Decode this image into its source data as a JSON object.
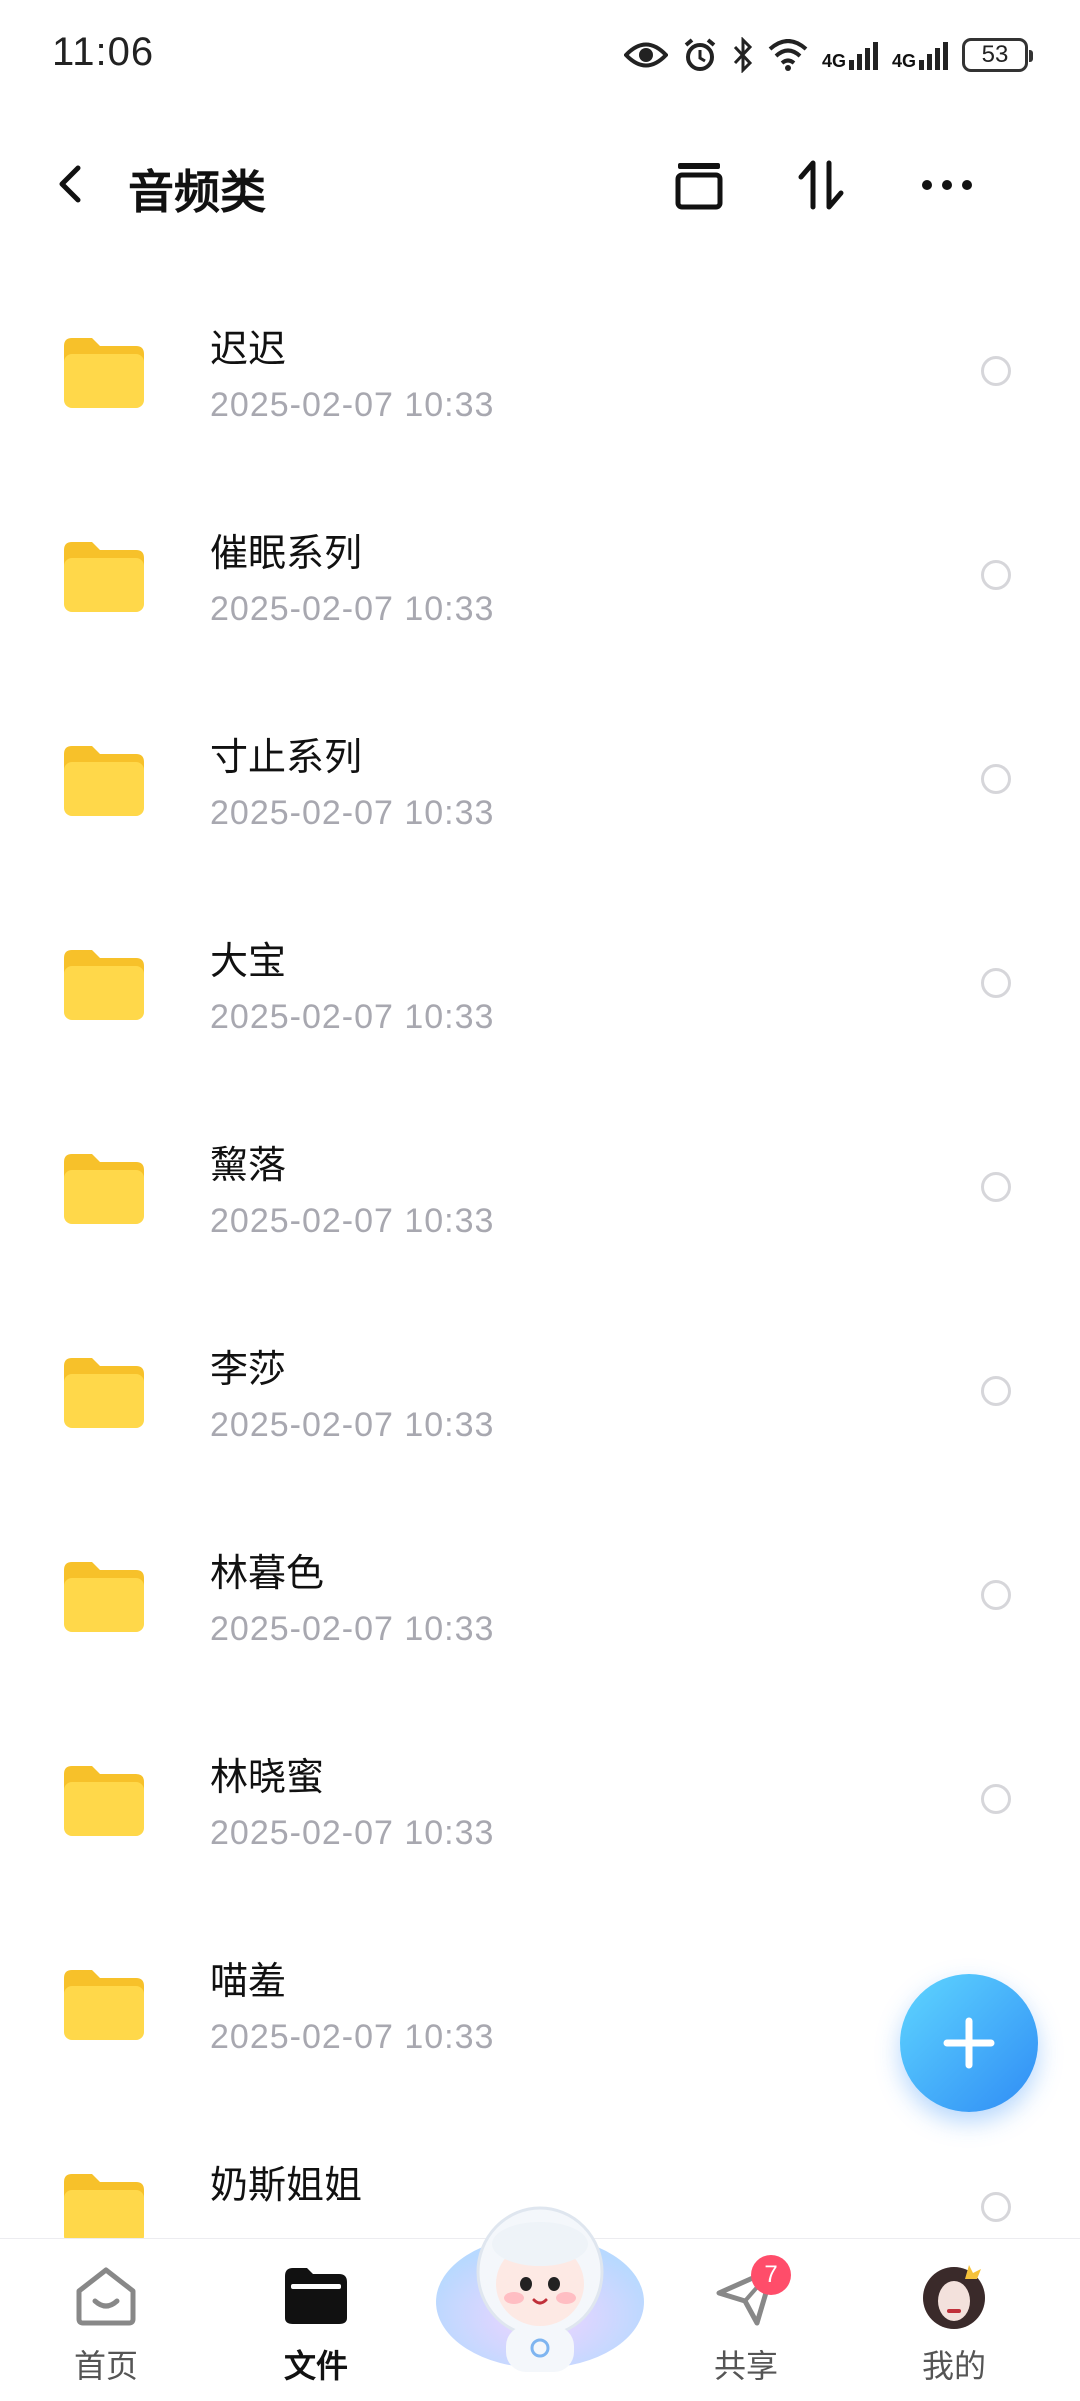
{
  "status_bar": {
    "time": "11:06",
    "network1": "4G",
    "network2": "4G",
    "battery": "53",
    "icons": [
      "eye-icon",
      "alarm-icon",
      "bluetooth-icon",
      "wifi-icon",
      "signal-icon",
      "signal-icon",
      "battery-icon"
    ]
  },
  "header": {
    "title": "音频类",
    "actions": [
      "archive-icon",
      "sort-icon",
      "more-icon"
    ]
  },
  "files": [
    {
      "name": "迟迟",
      "date": "2025-02-07  10:33"
    },
    {
      "name": "催眠系列",
      "date": "2025-02-07  10:33"
    },
    {
      "name": "寸止系列",
      "date": "2025-02-07  10:33"
    },
    {
      "name": "大宝",
      "date": "2025-02-07  10:33"
    },
    {
      "name": "黧落",
      "date": "2025-02-07  10:33"
    },
    {
      "name": "李莎",
      "date": "2025-02-07  10:33"
    },
    {
      "name": "林暮色",
      "date": "2025-02-07  10:33"
    },
    {
      "name": "林晓蜜",
      "date": "2025-02-07  10:33"
    },
    {
      "name": "喵羞",
      "date": "2025-02-07  10:33"
    },
    {
      "name": "奶斯姐姐",
      "date": ""
    }
  ],
  "nav": {
    "home": "首页",
    "files": "文件",
    "share": "共享",
    "share_badge": "7",
    "mine": "我的"
  },
  "colors": {
    "folder": "#ffd23f",
    "accent": "#2f8cf5",
    "date_text": "#a8a8b0",
    "badge": "#ff4d6a"
  }
}
